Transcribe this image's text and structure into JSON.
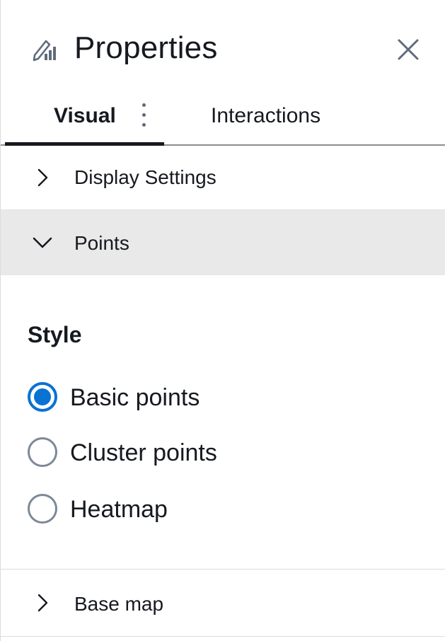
{
  "header": {
    "title": "Properties",
    "icon": "visual-properties-icon",
    "close_icon": "close-icon"
  },
  "tabs": [
    {
      "label": "Visual",
      "active": true
    },
    {
      "label": "Interactions",
      "active": false
    }
  ],
  "sections": {
    "display_settings": {
      "label": "Display Settings",
      "expanded": false
    },
    "points": {
      "label": "Points",
      "expanded": true
    },
    "base_map": {
      "label": "Base map",
      "expanded": false
    }
  },
  "style_group": {
    "heading": "Style",
    "selected": "Basic points",
    "options": [
      {
        "label": "Basic points",
        "checked": true
      },
      {
        "label": "Cluster points",
        "checked": false
      },
      {
        "label": "Heatmap",
        "checked": false
      }
    ]
  },
  "colors": {
    "accent": "#0972d3",
    "text": "#16191f",
    "expanded_section_bg": "#e9e9e9"
  }
}
